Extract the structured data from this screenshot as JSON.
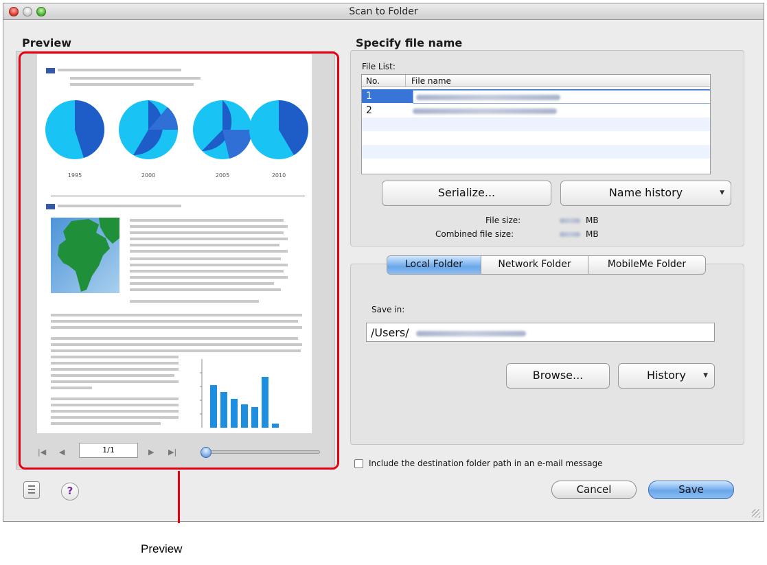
{
  "window": {
    "title": "Scan to Folder"
  },
  "preview": {
    "heading": "Preview",
    "page_indicator": "1/1",
    "doc_years": [
      "1995",
      "2000",
      "2005",
      "2010"
    ],
    "nav_icons": [
      "first-page-icon",
      "previous-page-icon",
      "next-page-icon",
      "last-page-icon"
    ]
  },
  "file_spec": {
    "heading": "Specify file name",
    "file_list_label": "File List:",
    "columns": [
      "No.",
      "File name"
    ],
    "rows": [
      {
        "no": "1"
      },
      {
        "no": "2"
      }
    ],
    "serialize_button": "Serialize...",
    "name_history_button": "Name history",
    "file_size_label": "File size:",
    "file_size_unit": "MB",
    "combined_size_label": "Combined file size:",
    "combined_size_unit": "MB"
  },
  "destination": {
    "tabs": [
      "Local Folder",
      "Network Folder",
      "MobileMe Folder"
    ],
    "active_tab": "Local Folder",
    "save_in_label": "Save in:",
    "path_value": "/Users/",
    "browse_button": "Browse...",
    "history_button": "History"
  },
  "footer": {
    "include_path_label": "Include the destination folder path in an e-mail message",
    "include_path_checked": false,
    "cancel_button": "Cancel",
    "save_button": "Save",
    "help_glyph": "?"
  },
  "annotation": {
    "callout": "Preview"
  },
  "colors": {
    "accent": "#3875d7",
    "callout_red": "#e50012",
    "pie_light": "#19c4f4",
    "pie_dark": "#1e5cc8"
  }
}
